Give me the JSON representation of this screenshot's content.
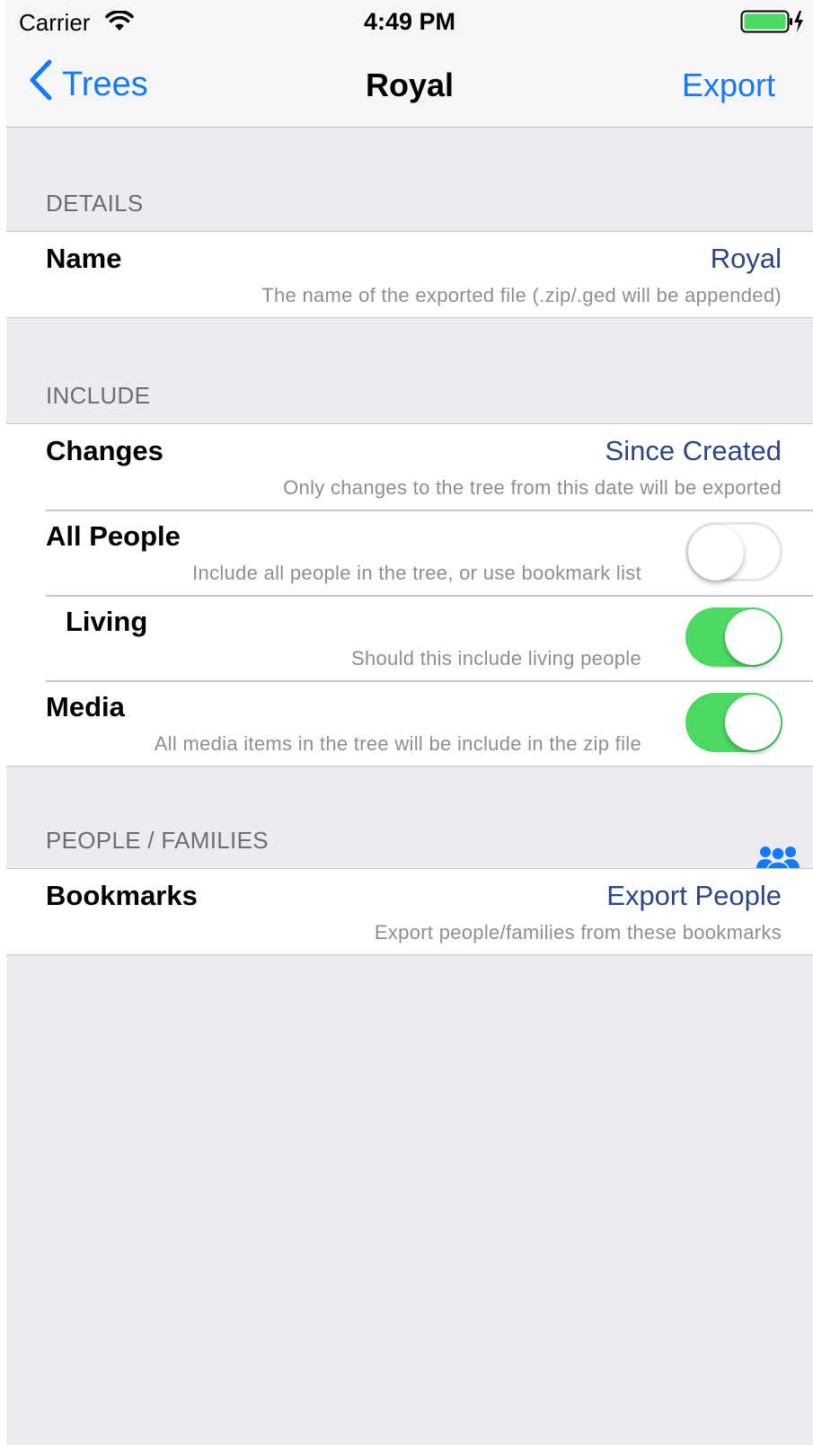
{
  "status_bar": {
    "carrier": "Carrier",
    "time": "4:49 PM",
    "wifi_icon": "wifi-icon",
    "battery_icon": "battery-charging-icon",
    "battery_color": "#4cd964"
  },
  "nav": {
    "back_label": "Trees",
    "title": "Royal",
    "export_label": "Export",
    "tint_color": "#1479fb"
  },
  "sections": {
    "details": {
      "header": "DETAILS",
      "name": {
        "title": "Name",
        "value": "Royal",
        "detail": "The name of the exported file (.zip/.ged will be appended)"
      }
    },
    "include": {
      "header": "INCLUDE",
      "changes": {
        "title": "Changes",
        "value": "Since Created",
        "detail": "Only changes to the tree from this date will be exported"
      },
      "all_people": {
        "title": "All People",
        "detail": "Include all people in the tree, or use bookmark list",
        "on": false
      },
      "living": {
        "title": "Living",
        "detail": "Should this include living people",
        "on": true
      },
      "media": {
        "title": "Media",
        "detail": "All media items in the tree will be include in the zip file",
        "on": true
      }
    },
    "people_families": {
      "header": "PEOPLE / FAMILIES",
      "icon": "people-group-icon",
      "bookmarks": {
        "title": "Bookmarks",
        "value": "Export People",
        "detail": "Export people/families from these bookmarks"
      }
    }
  }
}
